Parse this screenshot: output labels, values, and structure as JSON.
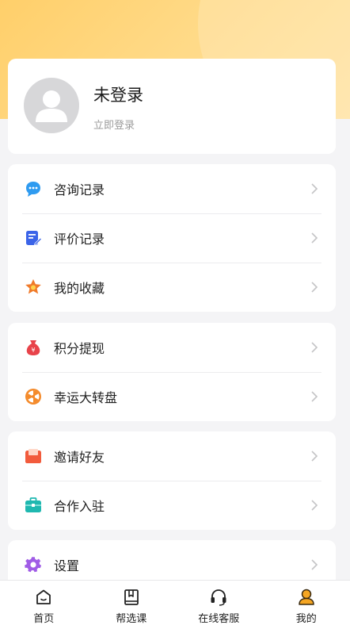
{
  "profile": {
    "username": "未登录",
    "login_link": "立即登录"
  },
  "groups": [
    [
      {
        "label": "咨询记录",
        "icon": "chat-bubble-icon"
      },
      {
        "label": "评价记录",
        "icon": "review-note-icon"
      },
      {
        "label": "我的收藏",
        "icon": "star-icon"
      }
    ],
    [
      {
        "label": "积分提现",
        "icon": "money-bag-icon"
      },
      {
        "label": "幸运大转盘",
        "icon": "lucky-wheel-icon"
      }
    ],
    [
      {
        "label": "邀请好友",
        "icon": "envelope-icon"
      },
      {
        "label": "合作入驻",
        "icon": "briefcase-icon"
      }
    ],
    [
      {
        "label": "设置",
        "icon": "gear-icon"
      }
    ]
  ],
  "tabbar": {
    "items": [
      {
        "label": "首页",
        "icon": "home-icon"
      },
      {
        "label": "帮选课",
        "icon": "book-icon"
      },
      {
        "label": "在线客服",
        "icon": "headset-icon"
      },
      {
        "label": "我的",
        "icon": "user-icon",
        "active": true
      }
    ]
  },
  "colors": {
    "header_gradient_start": "#ffcf6a",
    "header_gradient_end": "#ffe2a0",
    "active_tab_icon": "#f5a623"
  }
}
